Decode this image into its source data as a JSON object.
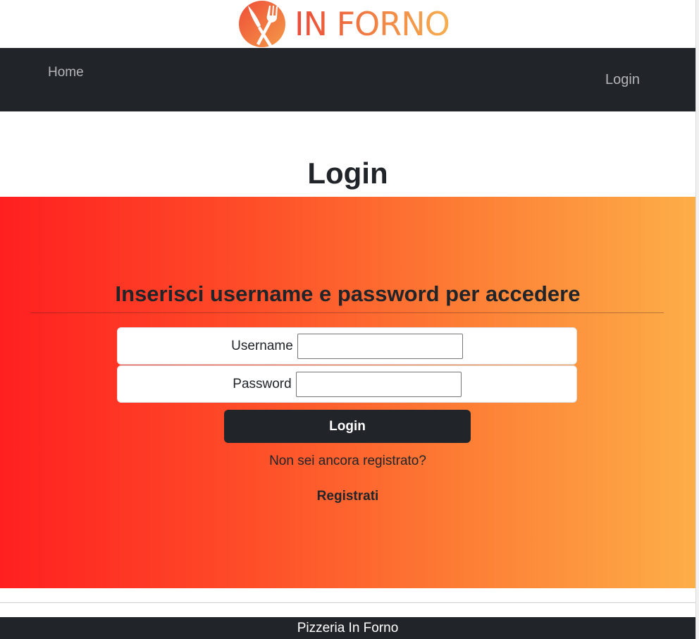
{
  "brand": {
    "name": "IN FORNO",
    "logo_icon": "fork-and-knife-icon",
    "colors": {
      "gradient_start": "#ec4a37",
      "gradient_end": "#f6ae50"
    }
  },
  "navbar": {
    "home_label": "Home",
    "login_label": "Login",
    "background": "#212529"
  },
  "page": {
    "title": "Login"
  },
  "login_form": {
    "heading": "Inserisci username e password per accedere",
    "username_label": "Username",
    "username_value": "",
    "password_label": "Password",
    "password_value": "",
    "submit_label": "Login",
    "not_registered_text": "Non sei ancora registrato?",
    "register_link": "Registrati",
    "band_gradient": [
      "#ff1f20",
      "#fe4c28",
      "#fd7b34",
      "#fdae48"
    ]
  },
  "footer": {
    "text": "Pizzeria In Forno"
  }
}
